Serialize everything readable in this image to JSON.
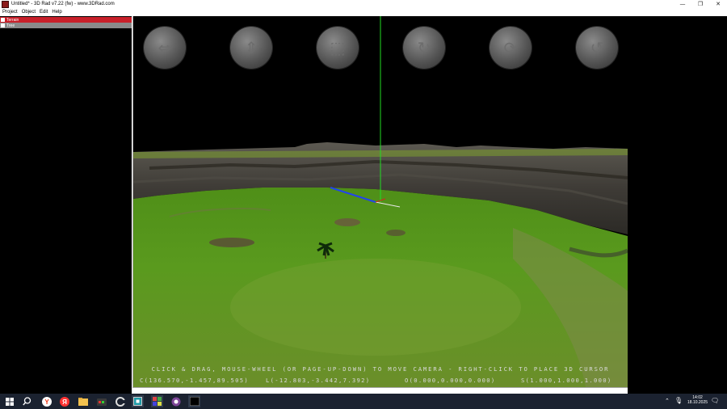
{
  "window": {
    "title": "Untitled* - 3D Rad v7.22 (fw) - www.3DRad.com",
    "minimize": "—",
    "maximize": "❐",
    "close": "✕"
  },
  "menu": [
    "Project",
    "Object",
    "Edit",
    "Help"
  ],
  "objects": [
    {
      "label": "Terrain",
      "selected": true
    },
    {
      "label": "Tree",
      "selected": false
    }
  ],
  "viewport": {
    "help_text": "CLICK & DRAG, MOUSE-WHEEL (OR PAGE-UP-DOWN) TO MOVE CAMERA - RIGHT-CLICK TO PLACE 3D CURSOR",
    "c_readout": "C(136.570,-1.457,89.505)",
    "l_readout": "L(-12.803,-3.442,7.392)",
    "o_readout": "O(0.000,0.000,0.000)",
    "s_readout": "S(1.000,1.000,1.000)",
    "nav_icons": [
      "move-horizontal-icon",
      "move-vertical-icon",
      "move-plane-icon",
      "rotate-icon",
      "orbit-icon",
      "spin-icon"
    ]
  },
  "taskbar": {
    "apps": [
      "windows-start-icon",
      "search-icon",
      "yandex-browser-icon",
      "yandex-icon",
      "file-explorer-icon",
      "media-app-icon",
      "ccleaner-icon",
      "app-icon",
      "3drad-app-icon",
      "tor-browser-icon",
      "terminal-icon"
    ],
    "time": "14:02",
    "date": "18.10.2025"
  }
}
